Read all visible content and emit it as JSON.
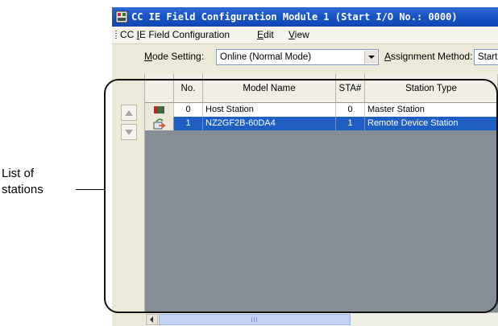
{
  "annotation": {
    "line1": "List of",
    "line2": "stations"
  },
  "window": {
    "title": "CC IE Field Configuration Module 1 (Start I/O No.: 0000)"
  },
  "menu": {
    "items": [
      {
        "pre": "CC ",
        "u": "I",
        "post": "E Field Configuration"
      },
      {
        "pre": "",
        "u": "E",
        "post": "dit"
      },
      {
        "pre": "",
        "u": "V",
        "post": "iew"
      }
    ]
  },
  "toolbar": {
    "mode_label": {
      "pre": "",
      "u": "M",
      "post": "ode Setting:"
    },
    "mode_value": "Online (Normal Mode)",
    "assign_label": {
      "pre": "",
      "u": "A",
      "post": "ssignment Method:"
    },
    "assign_value": "Start"
  },
  "table": {
    "headers": [
      "No.",
      "Model Name",
      "STA#",
      "Station Type"
    ],
    "rows": [
      {
        "no": "0",
        "model": "Host Station",
        "sta": "0",
        "type": "Master Station",
        "icon": "master-station-icon"
      },
      {
        "no": "1",
        "model": "NZ2GF2B-60DA4",
        "sta": "1",
        "type": "Remote Device Station",
        "icon": "remote-device-icon"
      }
    ]
  },
  "colors": {
    "titlebar": "#1a55c6",
    "selected_row": "#1f5fc4",
    "grid_empty": "#868e95"
  }
}
